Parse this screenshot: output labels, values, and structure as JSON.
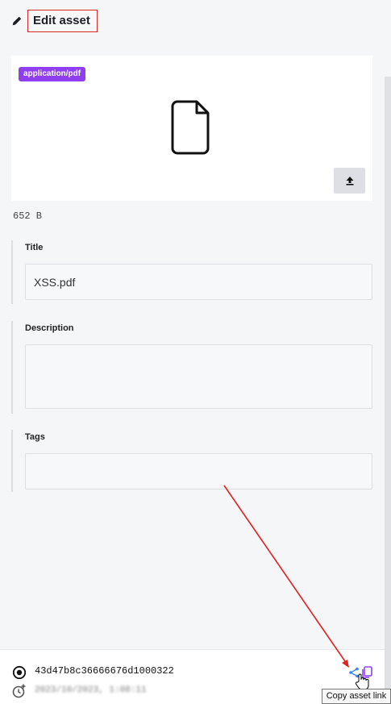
{
  "header": {
    "title": "Edit asset"
  },
  "preview": {
    "mime_type": "application/pdf"
  },
  "file_size": "652 B",
  "fields": {
    "title_label": "Title",
    "title_value": "XSS.pdf",
    "description_label": "Description",
    "description_value": "",
    "tags_label": "Tags",
    "tags_value": ""
  },
  "footer": {
    "hash": "43d47b8c36666676d1000322",
    "timestamp_blurred": "2023/10/2023, 1:08:11"
  },
  "tooltip": {
    "text": "Copy asset link"
  },
  "colors": {
    "accent": "#8f3ef0",
    "annotation": "#e0211f",
    "share_blue": "#3b82f6"
  }
}
